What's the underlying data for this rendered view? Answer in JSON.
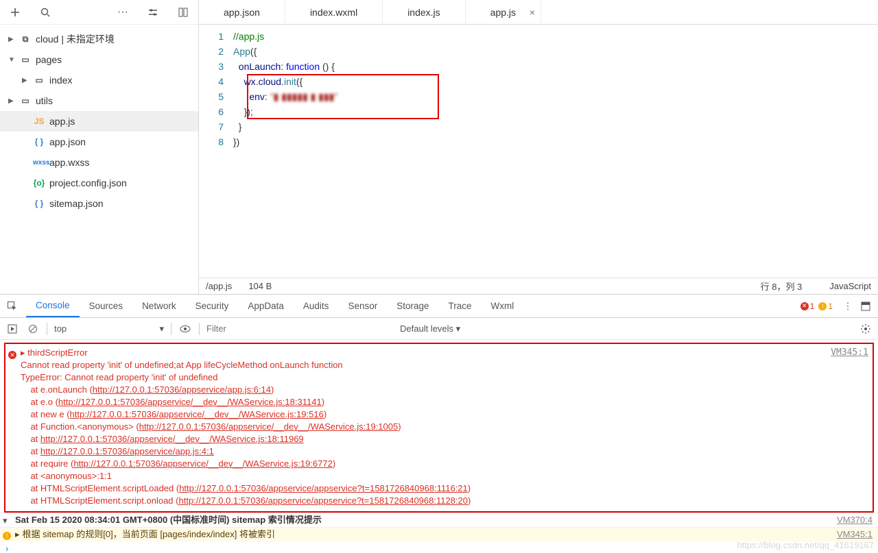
{
  "sidebar": {
    "items": [
      {
        "label": "cloud | 未指定环境",
        "icon": "cloud-folder-icon",
        "expandable": true,
        "expanded": false,
        "depth": 0
      },
      {
        "label": "pages",
        "icon": "folder-open-icon",
        "expandable": true,
        "expanded": true,
        "depth": 0
      },
      {
        "label": "index",
        "icon": "folder-icon",
        "expandable": true,
        "expanded": false,
        "depth": 1
      },
      {
        "label": "utils",
        "icon": "folder-icon",
        "expandable": true,
        "expanded": false,
        "depth": 0
      },
      {
        "label": "app.js",
        "icon": "js-icon",
        "depth": 1,
        "selected": true
      },
      {
        "label": "app.json",
        "icon": "json-icon",
        "depth": 1
      },
      {
        "label": "app.wxss",
        "icon": "wxss-icon",
        "depth": 1
      },
      {
        "label": "project.config.json",
        "icon": "cfg-icon",
        "depth": 1
      },
      {
        "label": "sitemap.json",
        "icon": "json-icon",
        "depth": 1
      }
    ]
  },
  "tabs": [
    {
      "label": "app.json"
    },
    {
      "label": "index.wxml"
    },
    {
      "label": "index.js"
    },
    {
      "label": "app.js",
      "active": true,
      "closable": true
    }
  ],
  "code": {
    "lines": [
      "1",
      "2",
      "3",
      "4",
      "5",
      "6",
      "7",
      "8"
    ],
    "l1_comment": "//app.js",
    "l2_ident": "App",
    "l2_rest": "({",
    "l3_prop": "onLaunch",
    "l3_mid": ": ",
    "l3_kw": "function",
    "l3_rest": " () {",
    "l4_a": "wx",
    "l4_b": ".",
    "l4_c": "cloud",
    "l4_d": ".",
    "l4_e": "init",
    "l4_f": "({",
    "l5_prop": "env",
    "l5_mid": ": ",
    "l5_str": "\"▮ ▮▮▮▮▮ ▮ ▮▮▮\"",
    "l6": "});",
    "l7": "}",
    "l8": "})"
  },
  "status": {
    "path": "/app.js",
    "size": "104 B",
    "pos": "行 8，列 3",
    "lang": "JavaScript"
  },
  "devtools": {
    "inspector_icon": "select-element",
    "tabs": [
      "Console",
      "Sources",
      "Network",
      "Security",
      "AppData",
      "Audits",
      "Sensor",
      "Storage",
      "Trace",
      "Wxml"
    ],
    "active_tab": "Console",
    "errors": "1",
    "warnings": "1",
    "context": "top",
    "filter_placeholder": "Filter",
    "levels": "Default levels ▾"
  },
  "console": {
    "err_source": "VM345:1",
    "err_title": "thirdScriptError",
    "err_l1": "Cannot read property 'init' of undefined;at App lifeCycleMethod onLaunch function",
    "err_l2": "TypeError: Cannot read property 'init' of undefined",
    "stack": [
      {
        "pre": "    at e.onLaunch (",
        "link": "http://127.0.0.1:57036/appservice/app.js:6:14",
        "suf": ")"
      },
      {
        "pre": "    at e.o (",
        "link": "http://127.0.0.1:57036/appservice/__dev__/WAService.js:18:31141",
        "suf": ")"
      },
      {
        "pre": "    at new e (",
        "link": "http://127.0.0.1:57036/appservice/__dev__/WAService.js:19:516",
        "suf": ")"
      },
      {
        "pre": "    at Function.<anonymous> (",
        "link": "http://127.0.0.1:57036/appservice/__dev__/WAService.js:19:1005",
        "suf": ")"
      },
      {
        "pre": "    at ",
        "link": "http://127.0.0.1:57036/appservice/__dev__/WAService.js:18:11969",
        "suf": ""
      },
      {
        "pre": "    at ",
        "link": "http://127.0.0.1:57036/appservice/app.js:4:1",
        "suf": ""
      },
      {
        "pre": "    at require (",
        "link": "http://127.0.0.1:57036/appservice/__dev__/WAService.js:19:6772",
        "suf": ")"
      },
      {
        "pre": "    at <anonymous>:1:1",
        "link": "",
        "suf": ""
      },
      {
        "pre": "    at HTMLScriptElement.scriptLoaded (",
        "link": "http://127.0.0.1:57036/appservice/appservice?t=1581726840968:1116:21",
        "suf": ")"
      },
      {
        "pre": "    at HTMLScriptElement.script.onload (",
        "link": "http://127.0.0.1:57036/appservice/appservice?t=1581726840968:1128:20",
        "suf": ")"
      }
    ],
    "info_row": {
      "text": "Sat Feb 15 2020 08:34:01 GMT+0800 (中国标准时间) sitemap 索引情况提示",
      "src": "VM370:4"
    },
    "warn_row": {
      "text": "根据 sitemap 的规则[0]，当前页面 [pages/index/index] 将被索引",
      "src": "VM345:1"
    },
    "prompt": "›"
  },
  "watermark": "https://blog.csdn.net/qq_41619167"
}
